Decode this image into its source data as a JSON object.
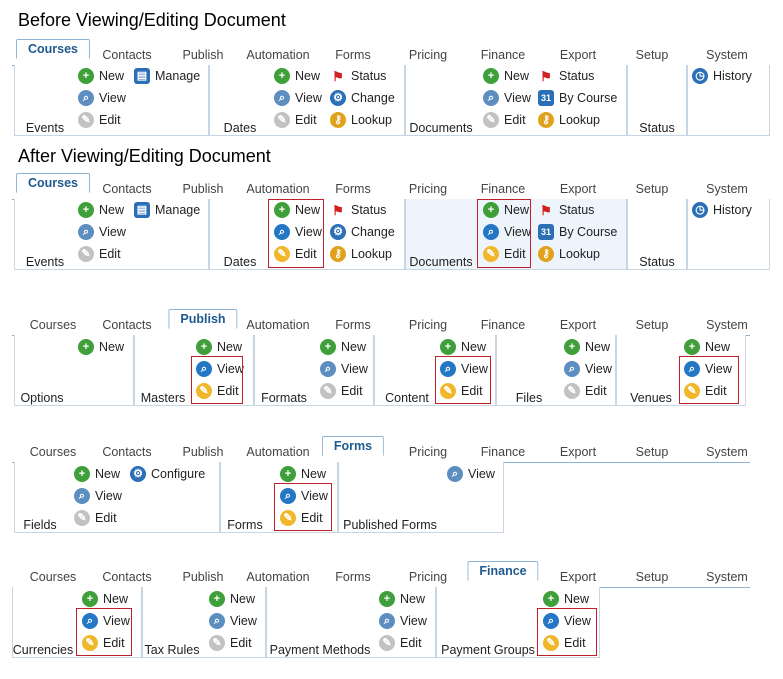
{
  "headings": {
    "before": "Before Viewing/Editing Document",
    "after": "After Viewing/Editing Document"
  },
  "tabs": [
    "Courses",
    "Contacts",
    "Publish",
    "Automation",
    "Forms",
    "Pricing",
    "Finance",
    "Export",
    "Setup",
    "System"
  ],
  "actions": {
    "new": "New",
    "view": "View",
    "edit": "Edit",
    "manage": "Manage",
    "status": "Status",
    "change": "Change",
    "lookup": "Lookup",
    "by_course": "By Course",
    "history": "History",
    "configure": "Configure"
  },
  "groups": {
    "events": "Events",
    "dates": "Dates",
    "documents": "Documents",
    "status": "Status",
    "options": "Options",
    "masters": "Masters",
    "formats": "Formats",
    "content": "Content",
    "files": "Files",
    "venues": "Venues",
    "fields": "Fields",
    "forms": "Forms",
    "published_forms": "Published Forms",
    "currencies": "Currencies",
    "tax_rules": "Tax Rules",
    "payment_methods": "Payment Methods",
    "payment_groups": "Payment Groups"
  },
  "icons": {
    "new": "plus-circle-icon",
    "view": "magnifier-icon",
    "edit": "pencil-icon",
    "manage": "folder-icon",
    "status": "flag-icon",
    "change": "gear-icon",
    "lookup": "key-icon",
    "by_course": "calendar-31-icon",
    "history": "clock-icon"
  },
  "colors": {
    "accent": "#1f5a8f",
    "tab_border": "#8fb3d4",
    "highlight": "#c0202a",
    "new": "#3f9f3a"
  }
}
